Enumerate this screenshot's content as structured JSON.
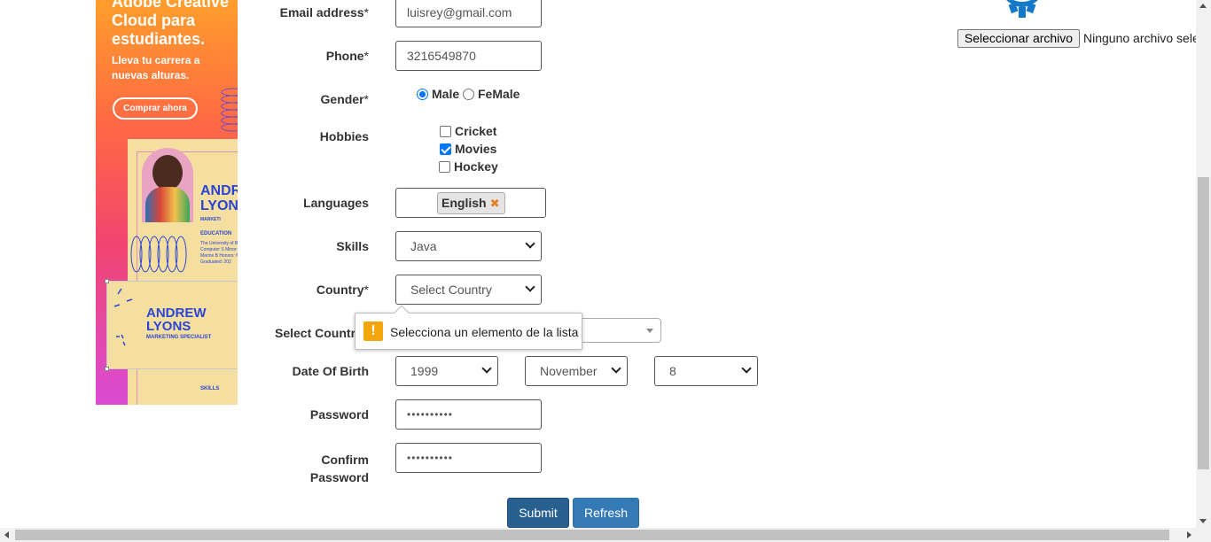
{
  "ad": {
    "headline": "Adobe Creative Cloud para estudiantes.",
    "subline": "Lleva tu carrera a nuevas alturas.",
    "cta": "Comprar ahora",
    "card_name": "ANDR LYON",
    "card_role": "MARKETI",
    "card_edu": "EDUCATION",
    "card_edu_text": "The University of B.S. Computer S Minor: Marine B Honors: Magna Graduated: 202",
    "selected_name": "ANDREW LYONS",
    "selected_role": "MARKETING SPECIALIST",
    "skills": "SKILLS"
  },
  "form": {
    "email": {
      "label": "Email address",
      "value": "luisrey@gmail.com"
    },
    "phone": {
      "label": "Phone",
      "value": "3216549870"
    },
    "gender": {
      "label": "Gender",
      "options": [
        "Male",
        "FeMale"
      ],
      "selected": "Male"
    },
    "hobbies": {
      "label": "Hobbies",
      "items": [
        {
          "label": "Cricket",
          "checked": false
        },
        {
          "label": "Movies",
          "checked": true
        },
        {
          "label": "Hockey",
          "checked": false
        }
      ]
    },
    "languages": {
      "label": "Languages",
      "chip": "English"
    },
    "skills": {
      "label": "Skills",
      "value": "Java"
    },
    "country": {
      "label": "Country",
      "value": "Select Country"
    },
    "select_country": {
      "label": "Select Country"
    },
    "dob": {
      "label": "Date Of Birth",
      "year": "1999",
      "month": "November",
      "day": "8"
    },
    "password": {
      "label": "Password",
      "value": "••••••••••"
    },
    "confirm_password": {
      "label": "Confirm Password",
      "label_line1": "Confirm",
      "label_line2": "Password",
      "value": "••••••••••"
    },
    "required_mark": "*",
    "submit": "Submit",
    "refresh": "Refresh"
  },
  "tooltip": {
    "message": "Selecciona un elemento de la lista",
    "icon": "warning-icon"
  },
  "file": {
    "button": "Seleccionar archivo",
    "status": "Ninguno archivo sele"
  },
  "colors": {
    "primary": "#286090",
    "primary_light": "#337ab7",
    "accent": "#0075ff",
    "warning": "#f3a50c"
  }
}
